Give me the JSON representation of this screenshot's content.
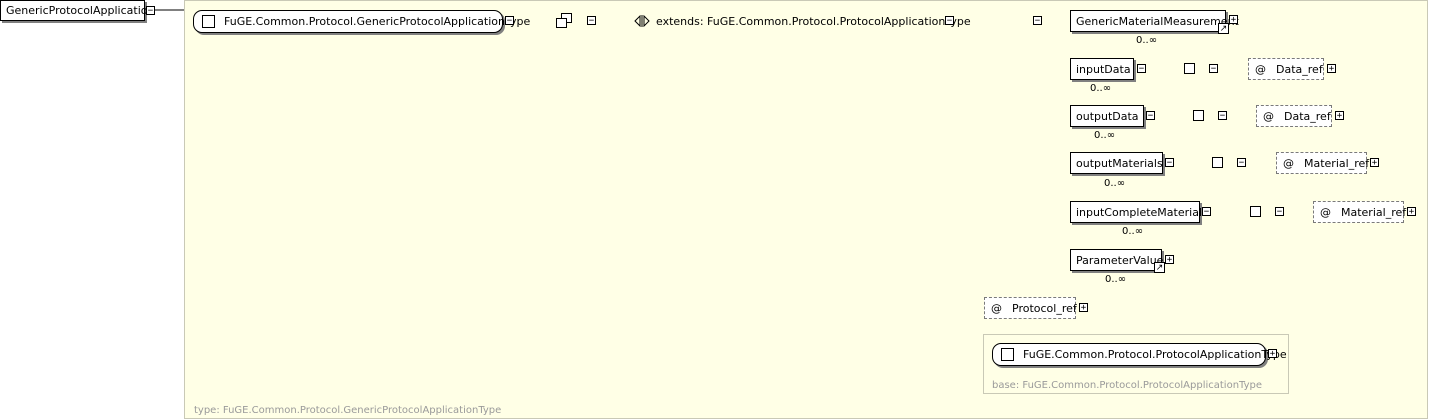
{
  "root_element": {
    "label": "GenericProtocolApplication",
    "toggle": "−"
  },
  "complex_type": {
    "name": "FuGE.Common.Protocol.GenericProtocolApplicationType",
    "type_caption": "type: FuGE.Common.Protocol.GenericProtocolApplicationType",
    "toggle": "−"
  },
  "extension": {
    "label": "extends: FuGE.Common.Protocol.ProtocolApplicationType",
    "toggle": "−"
  },
  "sequence": {
    "toggle": "−"
  },
  "children": [
    {
      "label": "GenericMaterialMeasurement",
      "cardinality": "0..∞",
      "expand": "+",
      "is_reference": true
    },
    {
      "label": "inputData",
      "cardinality": "0..∞",
      "toggle": "−",
      "attribute": "Data_ref",
      "attr_expand": "+"
    },
    {
      "label": "outputData",
      "cardinality": "0..∞",
      "toggle": "−",
      "attribute": "Data_ref",
      "attr_expand": "+"
    },
    {
      "label": "outputMaterials",
      "cardinality": "0..∞",
      "toggle": "−",
      "attribute": "Material_ref",
      "attr_expand": "+"
    },
    {
      "label": "inputCompleteMaterials",
      "cardinality": "0..∞",
      "toggle": "−",
      "attribute": "Material_ref",
      "attr_expand": "+"
    },
    {
      "label": "ParameterValue",
      "cardinality": "0..∞",
      "expand": "+",
      "is_reference": true
    }
  ],
  "protocol_ref": {
    "at_symbol": "@",
    "label": "Protocol_ref",
    "expand": "+"
  },
  "base_type": {
    "name": "FuGE.Common.Protocol.ProtocolApplicationType",
    "caption": "base: FuGE.Common.Protocol.ProtocolApplicationType",
    "expand": "+"
  },
  "symbols": {
    "at": "@",
    "ref_arrow": "↗"
  },
  "colors": {
    "panel_bg": "#ffffe6",
    "panel_border": "#c9c9b6",
    "caption_grey": "#9a9a9a"
  }
}
